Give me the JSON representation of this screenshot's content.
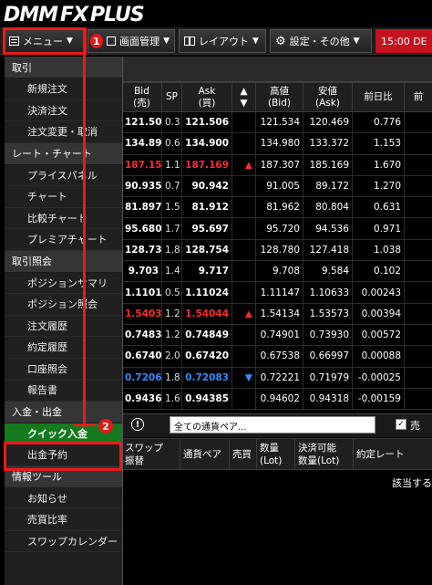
{
  "app": {
    "logo_main": "DMM",
    "logo_fx": "FX",
    "logo_plus": "PLUS"
  },
  "toolbar": {
    "menu_label": "メニュー",
    "badge1": "1",
    "screen_label": "画面管理",
    "layout_label": "レイアウト",
    "settings_label": "設定・その他",
    "time": "15:00 DE"
  },
  "menu": {
    "sections": [
      {
        "title": "取引",
        "items": [
          "新規注文",
          "決済注文",
          "注文変更・取消"
        ]
      },
      {
        "title": "レート・チャート",
        "items": [
          "プライスパネル",
          "チャート",
          "比較チャート",
          "プレミアチャート"
        ]
      },
      {
        "title": "取引照会",
        "items": [
          "ポジションサマリ",
          "ポジション照会",
          "注文履歴",
          "約定履歴",
          "口座照会",
          "報告書"
        ]
      },
      {
        "title": "入金・出金",
        "items": [
          "クイック入金",
          "出金予約"
        ]
      },
      {
        "title": "情報ツール",
        "items": [
          "お知らせ",
          "売買比率",
          "スワップカレンダー"
        ]
      }
    ],
    "badge2": "2"
  },
  "rates": {
    "headers": [
      "Bid\n(売)",
      "SP",
      "Ask\n(買)",
      "▲\n▼",
      "高値\n(Bid)",
      "安値\n(Ask)",
      "前日比",
      "前"
    ],
    "rows": [
      {
        "bid": "121.503",
        "sp": "0.3",
        "ask": "121.506",
        "dir": "",
        "high": "121.534",
        "low": "120.469",
        "chg": "0.776",
        "color": ""
      },
      {
        "bid": "134.894",
        "sp": "0.6",
        "ask": "134.900",
        "dir": "",
        "high": "134.980",
        "low": "133.372",
        "chg": "1.153",
        "color": ""
      },
      {
        "bid": "187.158",
        "sp": "1.1",
        "ask": "187.169",
        "dir": "▲",
        "high": "187.307",
        "low": "185.169",
        "chg": "1.670",
        "color": "up"
      },
      {
        "bid": "90.935",
        "sp": "0.7",
        "ask": "90.942",
        "dir": "",
        "high": "91.005",
        "low": "89.172",
        "chg": "1.270",
        "color": ""
      },
      {
        "bid": "81.897",
        "sp": "1.5",
        "ask": "81.912",
        "dir": "",
        "high": "81.962",
        "low": "80.804",
        "chg": "0.631",
        "color": ""
      },
      {
        "bid": "95.680",
        "sp": "1.7",
        "ask": "95.697",
        "dir": "",
        "high": "95.720",
        "low": "94.536",
        "chg": "0.971",
        "color": ""
      },
      {
        "bid": "128.736",
        "sp": "1.8",
        "ask": "128.754",
        "dir": "",
        "high": "128.780",
        "low": "127.418",
        "chg": "1.038",
        "color": ""
      },
      {
        "bid": "9.703",
        "sp": "1.4",
        "ask": "9.717",
        "dir": "",
        "high": "9.708",
        "low": "9.584",
        "chg": "0.102",
        "color": ""
      },
      {
        "bid": "1.11019",
        "sp": "0.5",
        "ask": "1.11024",
        "dir": "",
        "high": "1.11147",
        "low": "1.10633",
        "chg": "0.00243",
        "color": ""
      },
      {
        "bid": "1.54032",
        "sp": "1.2",
        "ask": "1.54044",
        "dir": "▲",
        "high": "1.54134",
        "low": "1.53573",
        "chg": "0.00394",
        "color": "up"
      },
      {
        "bid": "0.74837",
        "sp": "1.2",
        "ask": "0.74849",
        "dir": "",
        "high": "0.74901",
        "low": "0.73930",
        "chg": "0.00572",
        "color": ""
      },
      {
        "bid": "0.67400",
        "sp": "2.0",
        "ask": "0.67420",
        "dir": "",
        "high": "0.67538",
        "low": "0.66997",
        "chg": "0.00088",
        "color": ""
      },
      {
        "bid": "0.72065",
        "sp": "1.8",
        "ask": "0.72083",
        "dir": "▼",
        "high": "0.72221",
        "low": "0.71979",
        "chg": "-0.00025",
        "color": "dn"
      },
      {
        "bid": "0.94369",
        "sp": "1.6",
        "ask": "0.94385",
        "dir": "",
        "high": "0.94602",
        "low": "0.94318",
        "chg": "-0.00159",
        "color": ""
      }
    ]
  },
  "positions": {
    "select_value": "全ての通貨ペア...",
    "checkbox_label": "売",
    "checkbox_mark": "✓",
    "headers": [
      "スワップ\n振替",
      "通貨ペア",
      "売買",
      "数量\n(Lot)",
      "決済可能\n数量(Lot)",
      "約定レート"
    ],
    "empty_msg": "該当する"
  },
  "colors": {
    "up": "#ff2a2a",
    "down": "#2f8cff",
    "active_menu": "#157a1e",
    "annotation": "#ea1b1b"
  }
}
